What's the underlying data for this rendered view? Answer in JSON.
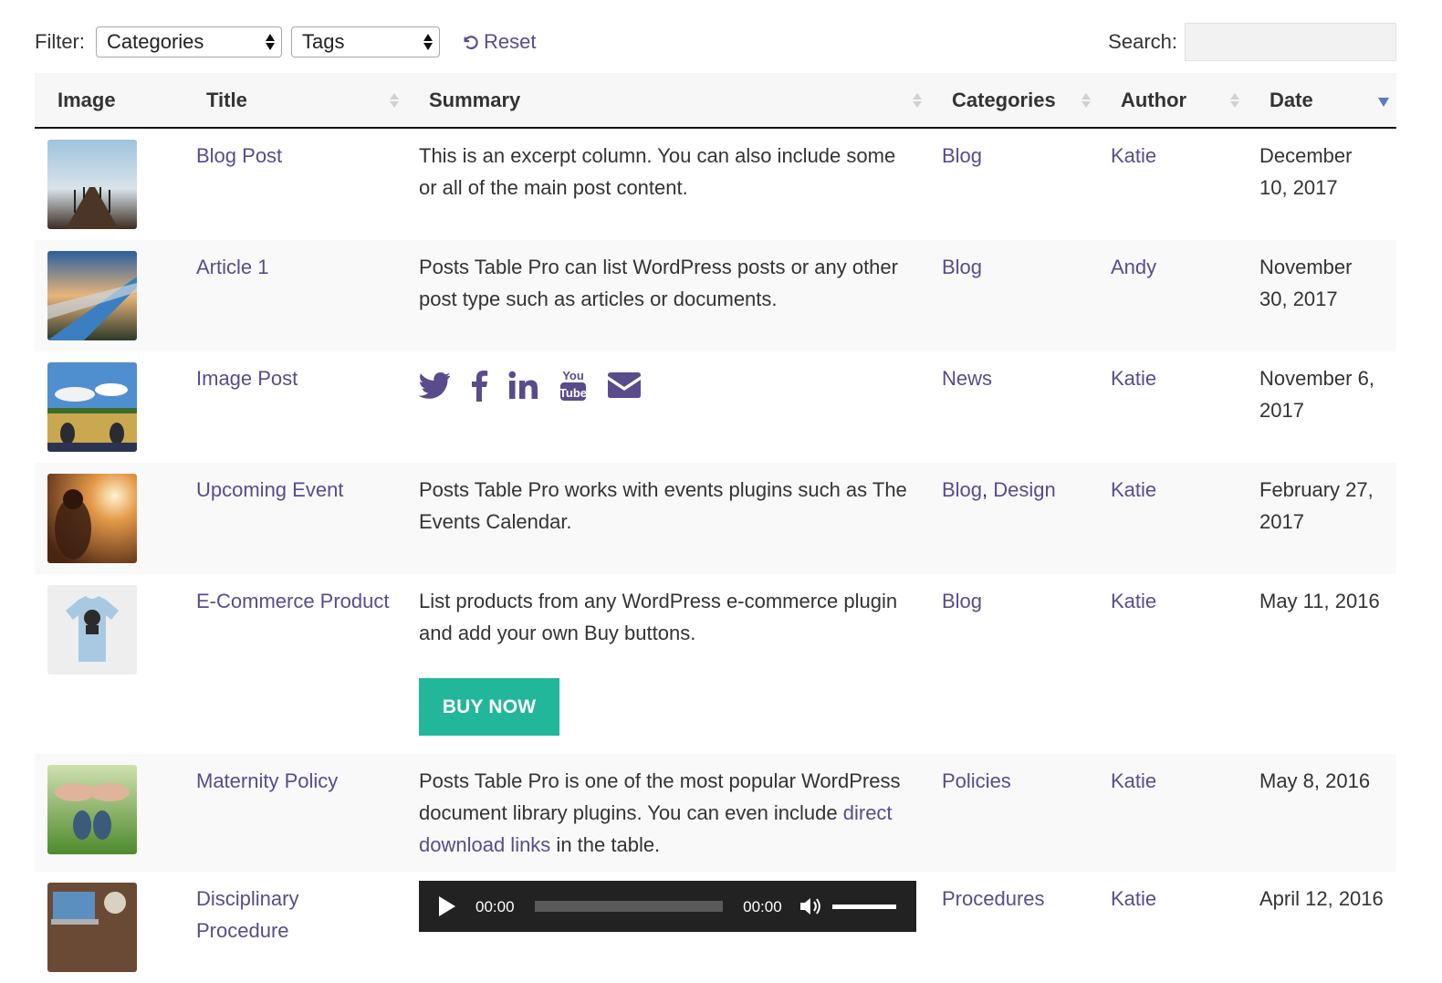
{
  "filter": {
    "label": "Filter:",
    "categories_value": "Categories",
    "tags_value": "Tags",
    "reset_label": "Reset"
  },
  "search": {
    "label": "Search:",
    "value": ""
  },
  "columns": [
    "Image",
    "Title",
    "Summary",
    "Categories",
    "Author",
    "Date"
  ],
  "rows": [
    {
      "image": "pier-photo",
      "title": "Blog Post",
      "summary": "This is an excerpt column. You can also include some or all of the main post content.",
      "categories": [
        "Blog"
      ],
      "author": "Katie",
      "date": "December 10, 2017"
    },
    {
      "image": "road-sky-photo",
      "title": "Article 1",
      "summary": "Posts Table Pro can list WordPress posts or any other post type such as articles or documents.",
      "categories": [
        "Blog"
      ],
      "author": "Andy",
      "date": "November 30, 2017"
    },
    {
      "image": "field-feet-photo",
      "title": "Image Post",
      "summary_icons": [
        "twitter-icon",
        "facebook-icon",
        "linkedin-icon",
        "youtube-icon",
        "email-icon"
      ],
      "categories": [
        "News"
      ],
      "author": "Katie",
      "date": "November 6, 2017"
    },
    {
      "image": "sunset-couple-photo",
      "title": "Upcoming Event",
      "summary": "Posts Table Pro works with events plugins such as The Events Calendar.",
      "categories": [
        "Blog",
        "Design"
      ],
      "author": "Katie",
      "date": "February 27, 2017"
    },
    {
      "image": "tshirt-photo",
      "title": "E-Commerce Product",
      "summary": "List products from any WordPress e-commerce plugin and add your own Buy buttons.",
      "button": "BUY NOW",
      "categories": [
        "Blog"
      ],
      "author": "Katie",
      "date": "May 11, 2016"
    },
    {
      "image": "baby-shoes-photo",
      "title": "Maternity Policy",
      "summary_pre": "Posts Table Pro is one of the most popular WordPress document library plugins. You can even include ",
      "summary_link": "direct download links",
      "summary_post": " in the table.",
      "categories": [
        "Policies"
      ],
      "author": "Katie",
      "date": "May 8, 2016"
    },
    {
      "image": "laptop-desk-photo",
      "title": "Disciplinary Procedure",
      "audio": {
        "current_time": "00:00",
        "duration": "00:00"
      },
      "categories": [
        "Procedures"
      ],
      "author": "Katie",
      "date": "April 12, 2016"
    }
  ],
  "colors": {
    "link": "#5a4b8c",
    "buy_button": "#22b69a",
    "sort_active": "#5a7bc0"
  }
}
